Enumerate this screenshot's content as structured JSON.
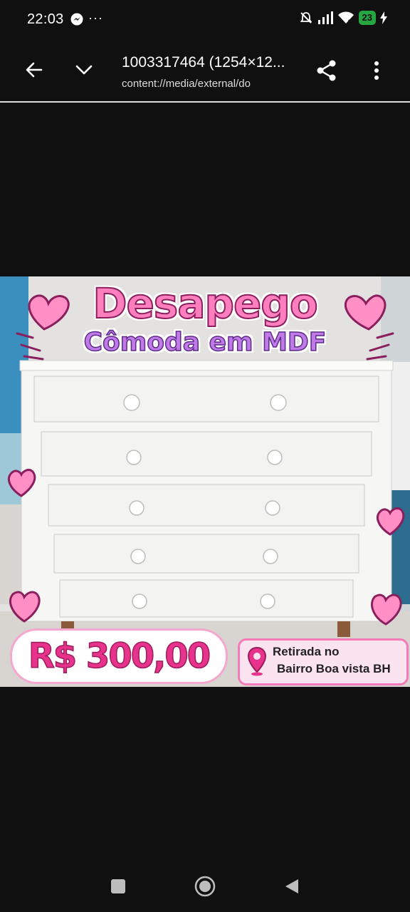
{
  "status_bar": {
    "time": "22:03",
    "more": "···",
    "battery_level": "23",
    "icons": [
      "messenger-icon",
      "bell-off-icon",
      "signal-icon",
      "wifi-icon",
      "battery-icon",
      "charging-icon"
    ]
  },
  "app_bar": {
    "title": "1003317464 (1254×12...",
    "subtitle": "content://media/external/do",
    "icons": [
      "back-arrow-icon",
      "chevron-down-icon",
      "share-icon",
      "more-vert-icon"
    ]
  },
  "image": {
    "headline": "Desapego",
    "subheadline": "Cômoda em MDF",
    "price": "R$ 300,00",
    "pickup_line1": "Retirada no",
    "pickup_line2": "Bairro Boa vista BH",
    "colors": {
      "pink": "#ff7fbe",
      "purple": "#c07ae8",
      "price": "#e8338c"
    }
  },
  "nav_bar": {
    "icons": [
      "recents-square-icon",
      "home-circle-icon",
      "back-triangle-icon"
    ]
  }
}
